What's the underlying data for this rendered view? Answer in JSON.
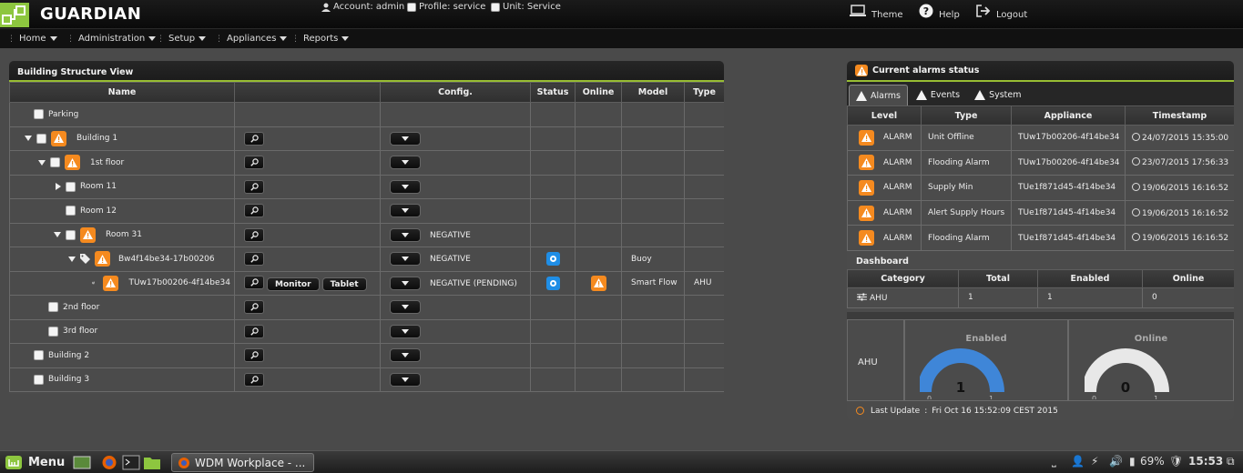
{
  "header": {
    "logo_text": "GUARDIAN",
    "account": "Account: admin",
    "profile": "Profile: service",
    "unit": "Unit: Service",
    "theme": "Theme",
    "help": "Help",
    "logout": "Logout"
  },
  "menu": [
    {
      "label": "Home"
    },
    {
      "label": "Administration"
    },
    {
      "label": "Setup"
    },
    {
      "label": "Appliances"
    },
    {
      "label": "Reports"
    }
  ],
  "building": {
    "title": "Building Structure View",
    "columns": [
      "Name",
      "",
      "Config.",
      "Status",
      "Online",
      "Model",
      "Type"
    ],
    "rows": [
      {
        "name": "Parking",
        "config": "",
        "model": "",
        "type": ""
      },
      {
        "name": "Building 1",
        "config": "",
        "model": "",
        "type": ""
      },
      {
        "name": "1st floor",
        "config": "",
        "model": "",
        "type": ""
      },
      {
        "name": "Room 11",
        "config": "",
        "model": "",
        "type": ""
      },
      {
        "name": "Room 12",
        "config": "",
        "model": "",
        "type": ""
      },
      {
        "name": "Room 31",
        "config": "NEGATIVE",
        "model": "",
        "type": ""
      },
      {
        "name": "Bw4f14be34-17b00206",
        "config": "NEGATIVE",
        "model": "Buoy",
        "type": ""
      },
      {
        "name": "TUw17b00206-4f14be34",
        "config": "NEGATIVE  (PENDING)",
        "model": "Smart Flow",
        "type": "AHU",
        "monitor": "Monitor",
        "tablet": "Tablet"
      },
      {
        "name": "2nd floor",
        "config": "",
        "model": "",
        "type": ""
      },
      {
        "name": "3rd floor",
        "config": "",
        "model": "",
        "type": ""
      },
      {
        "name": "Building 2",
        "config": "",
        "model": "",
        "type": ""
      },
      {
        "name": "Building 3",
        "config": "",
        "model": "",
        "type": ""
      }
    ]
  },
  "alarms": {
    "title": "Current alarms status",
    "tabs": [
      "Alarms",
      "Events",
      "System"
    ],
    "columns": [
      "Level",
      "Type",
      "Appliance",
      "Timestamp"
    ],
    "rows": [
      {
        "level": "ALARM",
        "type": "Unit Offline",
        "appliance": "TUw17b00206-4f14be34",
        "timestamp": "24/07/2015 15:35:00"
      },
      {
        "level": "ALARM",
        "type": "Flooding Alarm",
        "appliance": "TUw17b00206-4f14be34",
        "timestamp": "23/07/2015 17:56:33"
      },
      {
        "level": "ALARM",
        "type": "Supply Min",
        "appliance": "TUe1f871d45-4f14be34",
        "timestamp": "19/06/2015 16:16:52"
      },
      {
        "level": "ALARM",
        "type": "Alert Supply Hours",
        "appliance": "TUe1f871d45-4f14be34",
        "timestamp": "19/06/2015 16:16:52"
      },
      {
        "level": "ALARM",
        "type": "Flooding Alarm",
        "appliance": "TUe1f871d45-4f14be34",
        "timestamp": "19/06/2015 16:16:52"
      }
    ]
  },
  "dashboard": {
    "title": "Dashboard",
    "columns": [
      "Category",
      "Total",
      "Enabled",
      "Online"
    ],
    "row": {
      "category": "AHU",
      "total": "1",
      "enabled": "1",
      "online": "0"
    },
    "gauge_row_label": "AHU",
    "gauges": [
      {
        "label": "Enabled",
        "value": "1",
        "min": "0",
        "max": "1",
        "color": "#3f86d8"
      },
      {
        "label": "Online",
        "value": "0",
        "min": "0",
        "max": "1",
        "color": "#e8e8e8"
      }
    ],
    "last_update_label": "Last Update",
    "last_update_sep": ":",
    "last_update_value": "Fri Oct 16 15:52:09 CEST 2015"
  },
  "taskbar": {
    "menu": "Menu",
    "window": "WDM Workplace - ...",
    "battery": "69%",
    "clock": "15:53"
  },
  "colors": {
    "accent": "#98bd33",
    "warning": "#f58a1f",
    "status_blue": "#1f8ee6"
  }
}
